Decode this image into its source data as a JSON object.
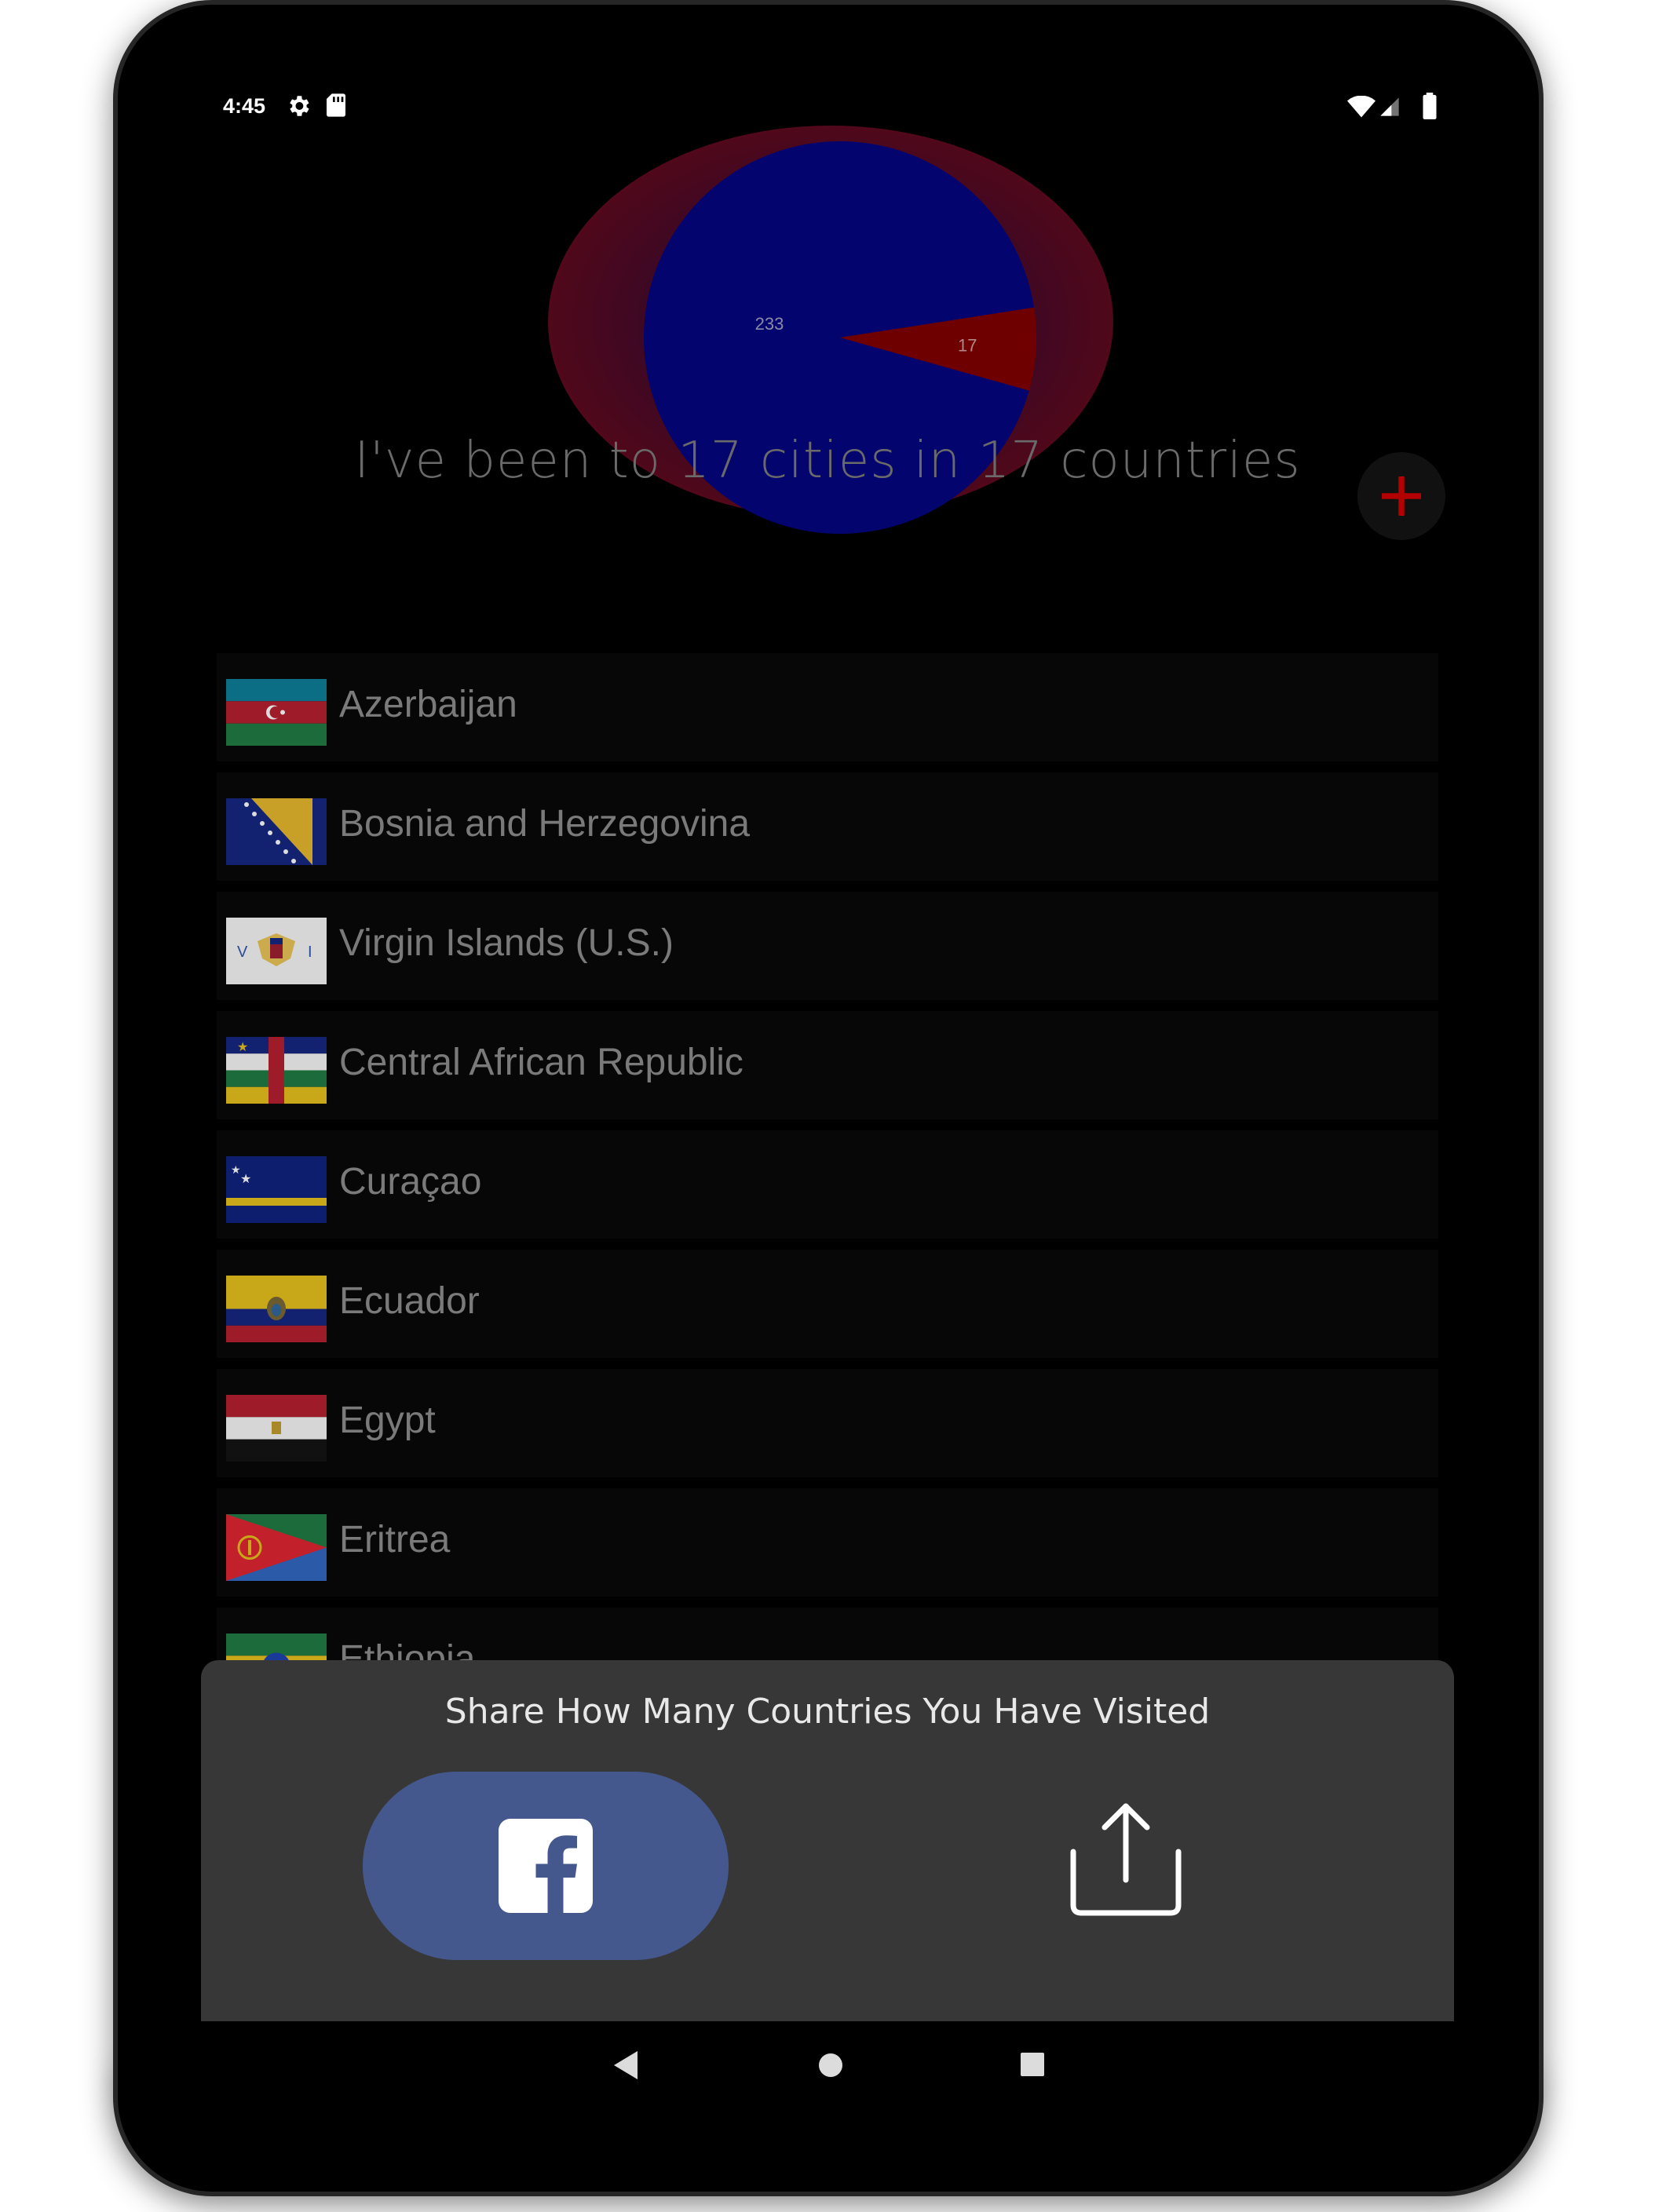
{
  "status_bar": {
    "time": "4:45",
    "icons": [
      "gear-icon",
      "sd-card-icon",
      "wifi-icon",
      "signal-icon",
      "battery-icon"
    ]
  },
  "chart_data": {
    "type": "pie",
    "categories": [
      "",
      ""
    ],
    "values": [
      233,
      17
    ],
    "labels": [
      "233",
      "17"
    ],
    "colors": [
      "#04046e",
      "#6e0000"
    ]
  },
  "headline": "I've been to 17 cities in 17 countries",
  "fab": {
    "icon": "plus-icon",
    "color": "#b30000"
  },
  "countries": [
    {
      "name": "Azerbaijan",
      "flag": "azerbaijan"
    },
    {
      "name": "Bosnia and Herzegovina",
      "flag": "bosnia"
    },
    {
      "name": "Virgin Islands (U.S.)",
      "flag": "usvi"
    },
    {
      "name": "Central African Republic",
      "flag": "car"
    },
    {
      "name": "Curaçao",
      "flag": "curacao"
    },
    {
      "name": "Ecuador",
      "flag": "ecuador"
    },
    {
      "name": "Egypt",
      "flag": "egypt"
    },
    {
      "name": "Eritrea",
      "flag": "eritrea"
    },
    {
      "name": "Ethiopia",
      "flag": "ethiopia"
    }
  ],
  "share": {
    "title": "Share How Many Countries You Have Visited",
    "facebook_icon": "facebook-icon",
    "share_icon": "share-icon",
    "facebook_color": "#45588e"
  },
  "nav": {
    "icons": [
      "back-icon",
      "home-icon",
      "recent-apps-icon"
    ]
  }
}
